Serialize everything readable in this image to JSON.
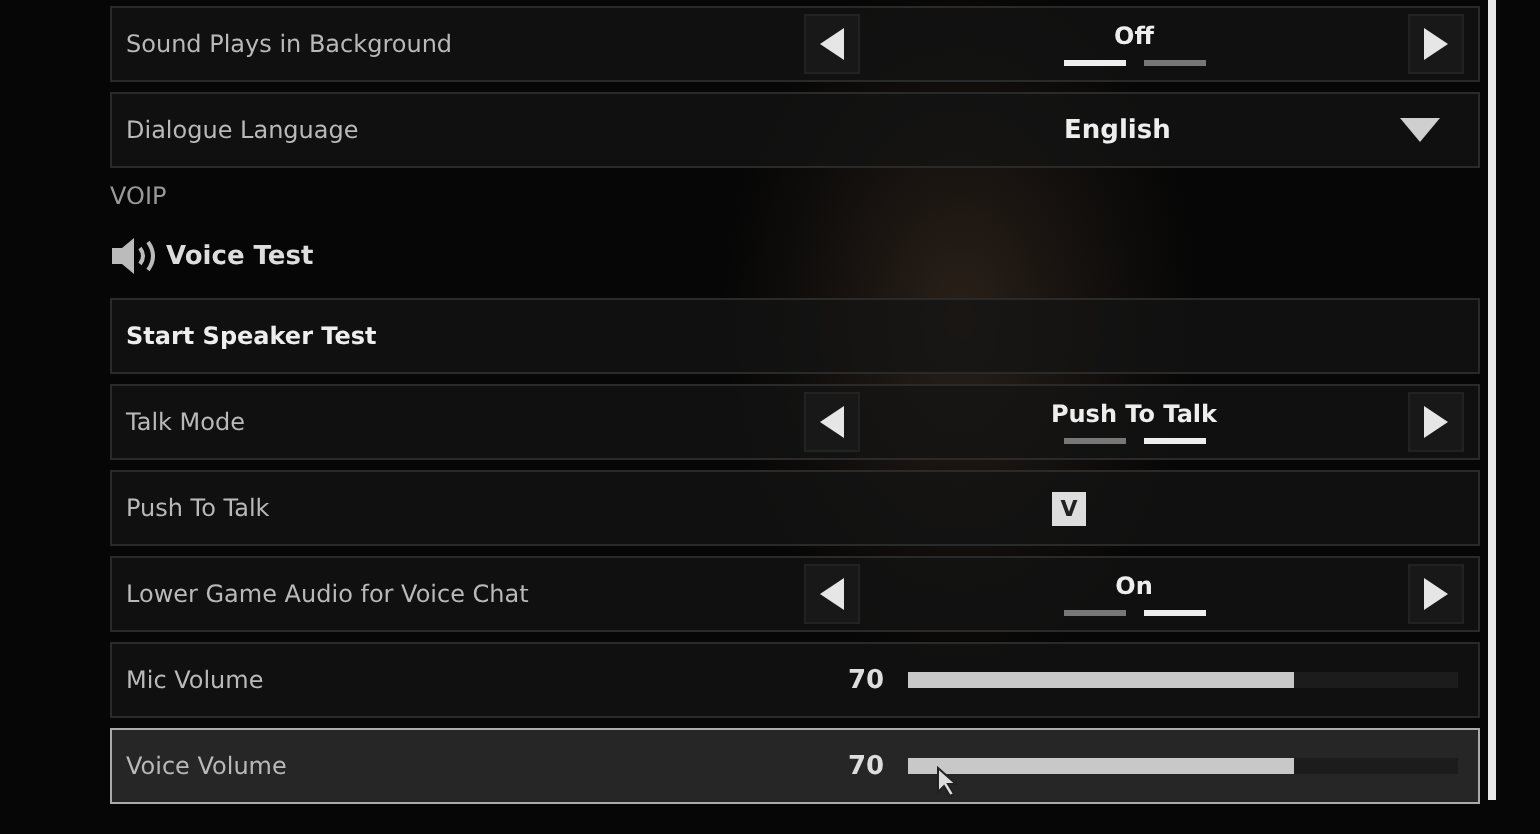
{
  "rows_top": [
    {
      "kind": "option",
      "label": "Sound Plays in Background",
      "value": "Off",
      "selected": false,
      "pips": [
        {
          "selected": true
        },
        {
          "selected": false
        }
      ]
    },
    {
      "kind": "dropdown",
      "label": "Dialogue Language",
      "value": "English",
      "selected": false
    }
  ],
  "section": "VOIP",
  "heading": "Voice Test",
  "rows": [
    {
      "kind": "button",
      "label": "Start Speaker Test",
      "selected": false
    },
    {
      "kind": "option",
      "label": "Talk Mode",
      "value": "Push To Talk",
      "selected": false,
      "pips": [
        {
          "selected": false
        },
        {
          "selected": true
        }
      ]
    },
    {
      "kind": "keybind",
      "label": "Push To Talk",
      "value": "V",
      "selected": false
    },
    {
      "kind": "option",
      "label": "Lower Game Audio for Voice Chat",
      "value": "On",
      "selected": false,
      "pips": [
        {
          "selected": false
        },
        {
          "selected": true
        }
      ]
    },
    {
      "kind": "slider",
      "label": "Mic Volume",
      "value": "70",
      "level": 0.7,
      "selected": false
    },
    {
      "kind": "slider",
      "label": "Voice Volume",
      "value": "70",
      "level": 0.7,
      "selected": true
    }
  ]
}
